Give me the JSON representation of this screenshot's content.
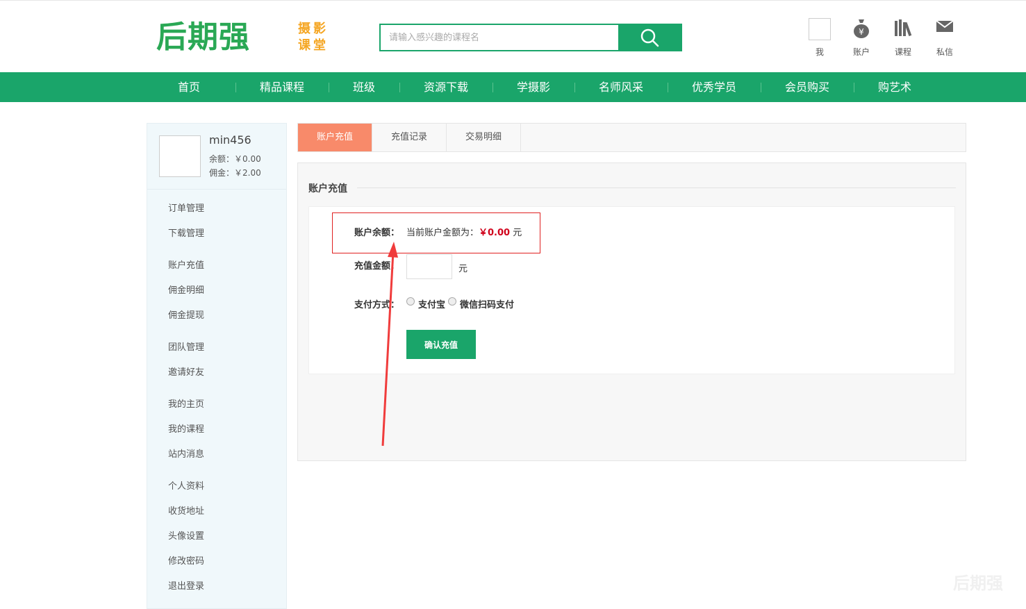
{
  "brand": {
    "logo_main": "后期强",
    "logo_sub": "摄影课堂",
    "watermark": "后期强"
  },
  "search": {
    "placeholder": "请输入感兴趣的课程名"
  },
  "top_icons": [
    {
      "label": "我",
      "icon": "avatar"
    },
    {
      "label": "账户",
      "icon": "money-bag-icon"
    },
    {
      "label": "课程",
      "icon": "books-icon"
    },
    {
      "label": "私信",
      "icon": "mail-icon"
    }
  ],
  "nav": [
    "首页",
    "精品课程",
    "班级",
    "资源下载",
    "学摄影",
    "名师风采",
    "优秀学员",
    "会员购买",
    "购艺术"
  ],
  "user": {
    "name": "min456",
    "balance": "余额：￥0.00",
    "commission": "佣金：￥2.00"
  },
  "menu": [
    [
      "订单管理",
      "下载管理"
    ],
    [
      "账户充值",
      "佣金明细",
      "佣金提现"
    ],
    [
      "团队管理",
      "邀请好友"
    ],
    [
      "我的主页",
      "我的课程",
      "站内消息"
    ],
    [
      "个人资料",
      "收货地址",
      "头像设置",
      "修改密码",
      "退出登录"
    ]
  ],
  "tabs": [
    "账户充值",
    "充值记录",
    "交易明细"
  ],
  "panel": {
    "title": "账户充值",
    "balance_label": "账户余额：",
    "balance_prefix": "当前账户金额为：",
    "balance_value": "￥0.00",
    "balance_unit": "元",
    "amount_label": "充值金额：",
    "amount_unit": "元",
    "pay_label": "支付方式：",
    "pay_options": [
      "支付宝",
      "微信扫码支付"
    ],
    "confirm": "确认充值"
  },
  "colors": {
    "brand_green": "#1aa56a",
    "tab_active": "#f88a6a",
    "highlight_red": "#e02020",
    "price_red": "#d0021b"
  }
}
